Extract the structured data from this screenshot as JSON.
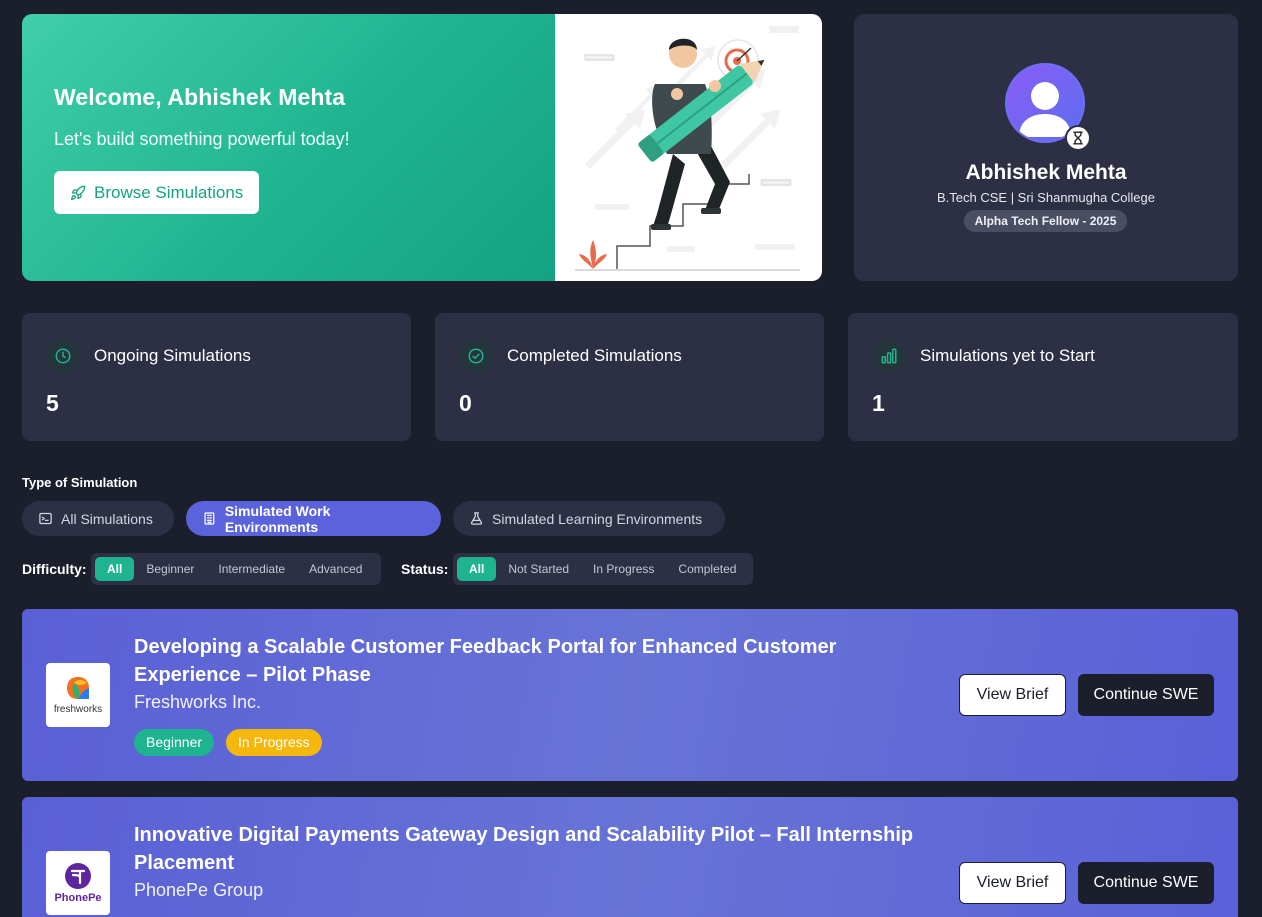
{
  "hero": {
    "title": "Welcome, Abhishek Mehta",
    "subtitle": "Let's build something powerful today!",
    "button_label": "Browse Simulations",
    "button_icon": "rocket-icon"
  },
  "profile": {
    "name": "Abhishek Mehta",
    "info": "B.Tech CSE | Sri Shanmugha College",
    "badge": "Alpha Tech Fellow - 2025",
    "badge_icon": "hourglass-icon"
  },
  "stats": [
    {
      "label": "Ongoing Simulations",
      "value": "5",
      "icon": "clock-icon"
    },
    {
      "label": "Completed Simulations",
      "value": "0",
      "icon": "check-circle-icon"
    },
    {
      "label": "Simulations yet to Start",
      "value": "1",
      "icon": "bar-chart-icon"
    }
  ],
  "filters": {
    "type_label": "Type of Simulation",
    "types": [
      {
        "label": "All Simulations",
        "icon": "terminal-icon",
        "active": false
      },
      {
        "label": "Simulated Work Environments",
        "icon": "building-icon",
        "active": true
      },
      {
        "label": "Simulated Learning Environments",
        "icon": "flask-icon",
        "active": false
      }
    ],
    "difficulty_label": "Difficulty:",
    "difficulty_options": [
      "All",
      "Beginner",
      "Intermediate",
      "Advanced"
    ],
    "difficulty_selected": "All",
    "status_label": "Status:",
    "status_options": [
      "All",
      "Not Started",
      "In Progress",
      "Completed"
    ],
    "status_selected": "All"
  },
  "cards": [
    {
      "title": "Developing a Scalable Customer Feedback Portal for Enhanced Customer Experience – Pilot Phase",
      "company": "Freshworks Inc.",
      "logo_text": "freshworks",
      "level": "Beginner",
      "status": "In Progress",
      "brief_label": "View Brief",
      "continue_label": "Continue SWE"
    },
    {
      "title": "Innovative Digital Payments Gateway Design and Scalability Pilot – Fall Internship Placement",
      "company": "PhonePe Group",
      "logo_text": "PhonePe",
      "brief_label": "View Brief",
      "continue_label": "Continue SWE"
    }
  ],
  "colors": {
    "background": "#1b1e2b",
    "panel": "#2d3045",
    "accent_green": "#1fb490",
    "accent_indigo": "#5b63dc",
    "status_yellow": "#f5b70b"
  }
}
